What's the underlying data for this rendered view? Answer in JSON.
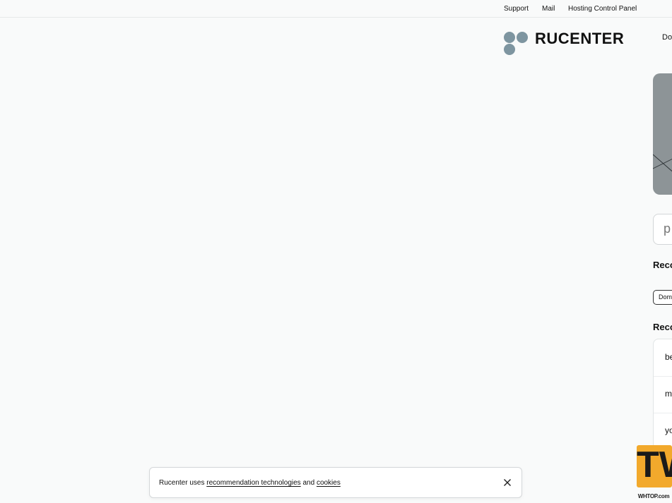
{
  "topbar": {
    "links": [
      "Support",
      "Mail",
      "Hosting Control Panel"
    ]
  },
  "header": {
    "logo_text": "RUCENTER",
    "nav_partial": "Do"
  },
  "search": {
    "placeholder_partial": "р"
  },
  "sections": {
    "recommended_heading_1": "Reco",
    "recommended_heading_2": "Reco"
  },
  "chips": [
    "Dom"
  ],
  "recommendations": [
    "be",
    "m",
    "yo"
  ],
  "cookie_banner": {
    "prefix": "Rucenter uses ",
    "link1": "recommendation technologies",
    "middle": " and ",
    "link2": "cookies"
  },
  "watermark": {
    "glyph": "TW",
    "label": "WHTOP.com"
  },
  "colors": {
    "background": "#f9fafa",
    "logo_dot": "#7e95a0",
    "hero": "#8d9497",
    "badge": "#f2a92c"
  }
}
